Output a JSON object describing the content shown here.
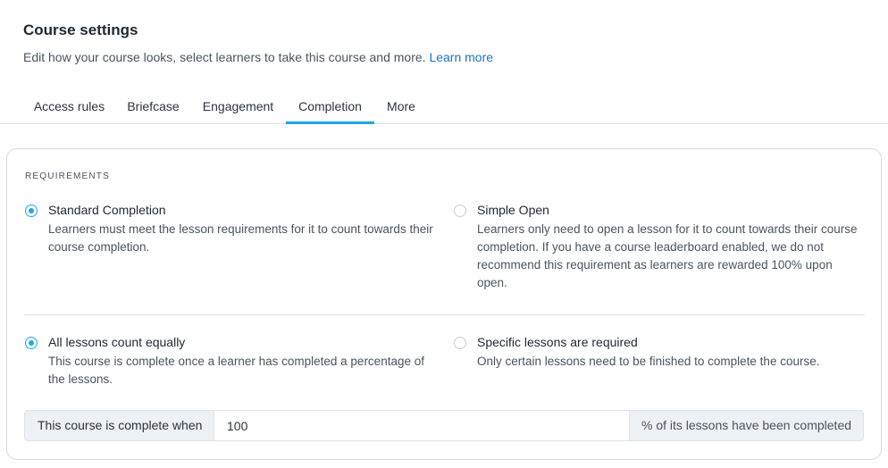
{
  "header": {
    "title": "Course settings",
    "subtitle": "Edit how your course looks, select learners to take this course and more.",
    "learn_more": "Learn more"
  },
  "tabs": [
    {
      "label": "Access rules",
      "active": false
    },
    {
      "label": "Briefcase",
      "active": false
    },
    {
      "label": "Engagement",
      "active": false
    },
    {
      "label": "Completion",
      "active": true
    },
    {
      "label": "More",
      "active": false
    }
  ],
  "requirements": {
    "section_label": "REQUIREMENTS",
    "mode_options": [
      {
        "title": "Standard Completion",
        "description": "Learners must meet the lesson requirements for it to count towards their course completion.",
        "selected": true
      },
      {
        "title": "Simple Open",
        "description": "Learners only need to open a lesson for it to count towards their course completion. If you have a course leaderboard enabled, we do not recommend this requirement as learners are rewarded 100% upon open.",
        "selected": false
      }
    ],
    "count_options": [
      {
        "title": "All lessons count equally",
        "description": "This course is complete once a learner has completed a percentage of the lessons.",
        "selected": true
      },
      {
        "title": "Specific lessons are required",
        "description": "Only certain lessons need to be finished to complete the course.",
        "selected": false
      }
    ],
    "completion_rule": {
      "prefix": "This course is complete when",
      "value": "100",
      "suffix": "% of its lessons have been completed"
    }
  },
  "colors": {
    "accent": "#1ea7e4",
    "link": "#1a74c8",
    "addon_bg": "#edf0f4"
  }
}
